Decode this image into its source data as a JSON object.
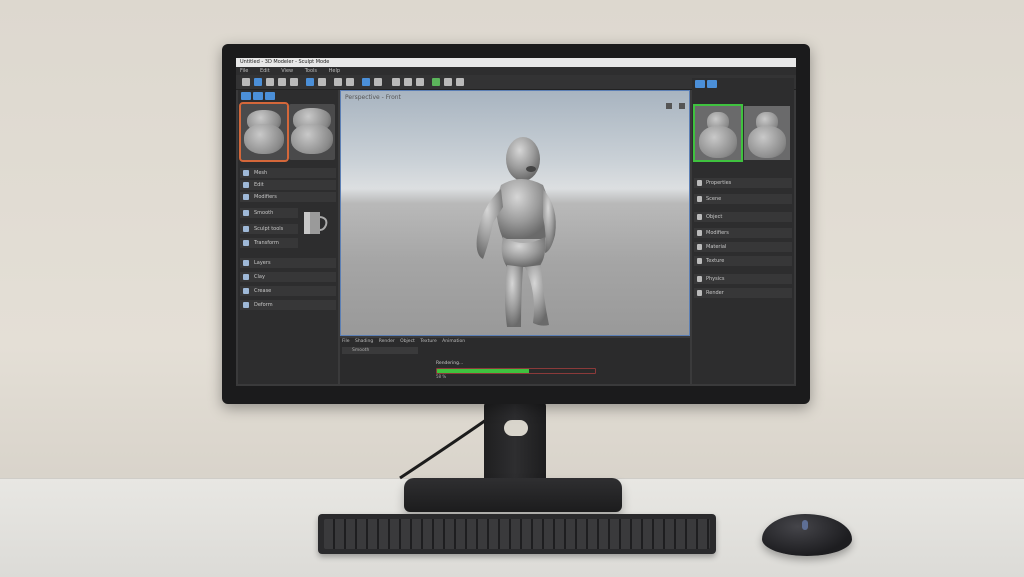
{
  "app": {
    "title": "Untitled - 3D Modeler - Sculpt Mode",
    "menu": [
      "File",
      "Edit",
      "View",
      "Tools",
      "Help"
    ]
  },
  "left_panel": {
    "rows": [
      "Mesh",
      "Edit",
      "Modifiers",
      "Smooth",
      "Sculpt tools",
      "Transform",
      "Layers",
      "Clay",
      "Crease",
      "Deform"
    ]
  },
  "viewport": {
    "label": "Perspective - Front"
  },
  "timeline": {
    "tabs": [
      "File",
      "Shading",
      "Render",
      "Object",
      "Texture",
      "Animation"
    ],
    "row_label": "Smooth",
    "progress_label": "Rendering...",
    "progress": 0.58,
    "progress_text": "58 %"
  },
  "right_panel": {
    "rows": [
      "Properties",
      "Scene",
      "Object",
      "Modifiers",
      "Material",
      "Texture",
      "Physics",
      "Render"
    ]
  },
  "colors": {
    "accent_blue": "#4b8fd8",
    "progress_green": "#3fc23f",
    "selection_orange": "#d4673a",
    "selection_green": "#3fc23f"
  }
}
